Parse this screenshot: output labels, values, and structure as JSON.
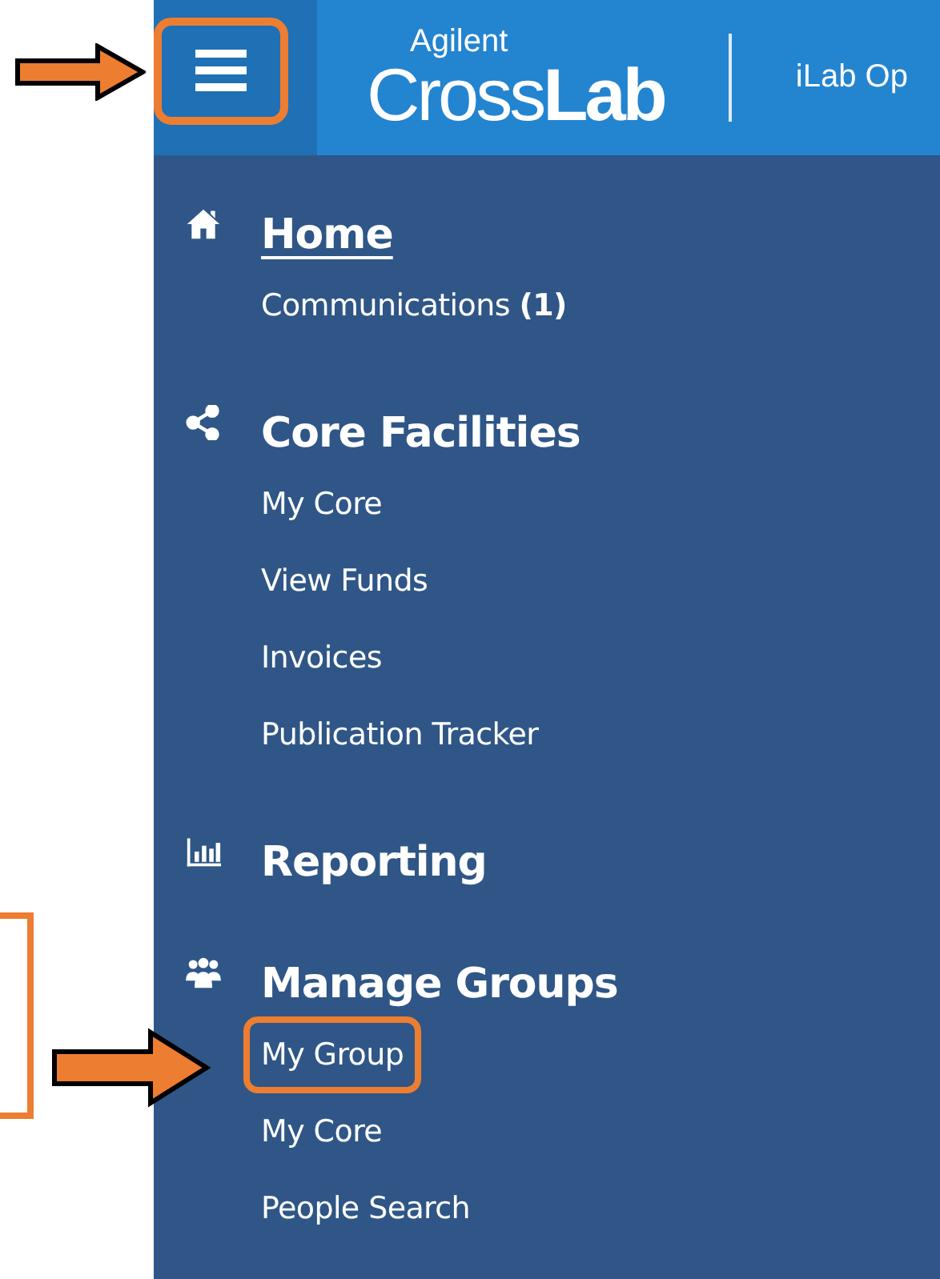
{
  "top_bar": {
    "menu_button": {
      "highlighted": true
    },
    "logo": {
      "small": "Agilent",
      "light": "Cross",
      "bold": "Lab"
    },
    "title": "iLab Op"
  },
  "sidebar": {
    "sections": [
      {
        "kind": "home",
        "label": "Home",
        "selected": true,
        "items": [
          {
            "label": "Communications **(1)**",
            "highlighted": false
          }
        ]
      },
      {
        "kind": "share",
        "label": "Core Facilities",
        "selected": false,
        "items": [
          {
            "label": "My Core",
            "highlighted": false
          },
          {
            "label": "View Funds",
            "highlighted": false
          },
          {
            "label": "Invoices",
            "highlighted": false
          },
          {
            "label": "Publication Tracker",
            "highlighted": false
          }
        ]
      },
      {
        "kind": "chart",
        "label": "Reporting",
        "selected": false
      },
      {
        "kind": "users",
        "label": "Manage Groups",
        "selected": false,
        "items": [
          {
            "label": "My Group",
            "highlighted": true
          },
          {
            "label": "My Core",
            "highlighted": false
          },
          {
            "label": "People Search",
            "highlighted": false
          }
        ]
      }
    ]
  }
}
